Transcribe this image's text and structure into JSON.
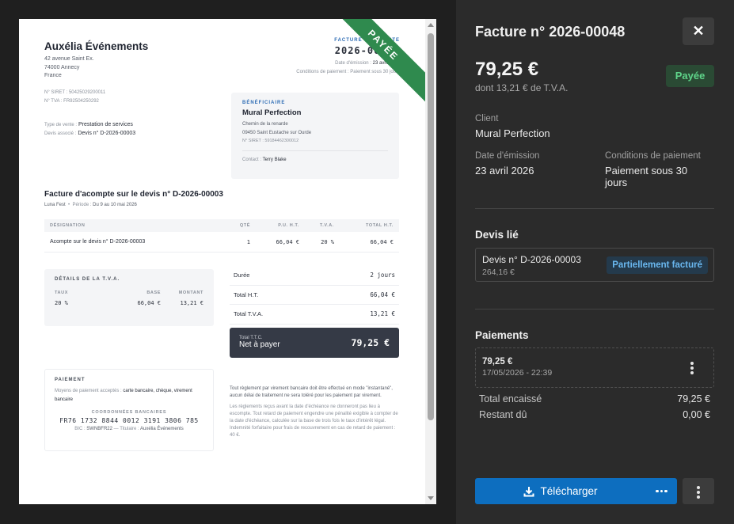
{
  "invoice_doc": {
    "company": {
      "name": "Auxélia Événements",
      "address_lines": [
        "42 avenue Saint Ex.",
        "74000 Annecy",
        "France"
      ],
      "siret": "N° SIRET : 50425029200011",
      "tva": "N° TVA : FR92504250292"
    },
    "sale_type_label": "Type de vente :",
    "sale_type_value": "Prestation de services",
    "quote_label": "Devis associé :",
    "quote_value": "Devis n° D-2026-00003",
    "header": {
      "label": "FACTURE D'ACOMPTE",
      "number": "2026-00048",
      "issue_label": "Date d'émission :",
      "issue_value": "23 avril 2026",
      "terms_label": "Conditions de paiement :",
      "terms_value": "Paiement sous 30 jours"
    },
    "ribbon": "PAYÉE",
    "beneficiary": {
      "label": "BÉNÉFICIAIRE",
      "name": "Mural Perfection",
      "address_lines": [
        "Chemin de la renarde",
        "09450 Saint Eustache sur Ourde"
      ],
      "siret": "N° SIRET : 59184462300012",
      "contact_label": "Contact :",
      "contact_value": "Terry Blake"
    },
    "title": "Facture d'acompte sur le devis n° D-2026-00003",
    "subtitle_event": "Luna Fest",
    "subtitle_period_label": "Période :",
    "subtitle_period_value": "Du 9 au 10 mai 2026",
    "items_headers": [
      "DÉSIGNATION",
      "QTÉ",
      "P.U. H.T.",
      "T.V.A.",
      "TOTAL H.T."
    ],
    "items_rows": [
      [
        "Acompte sur le devis n° D-2026-00003",
        "1",
        "66,04 €",
        "20 %",
        "66,04 €"
      ]
    ],
    "vat": {
      "label": "DÉTAILS DE LA T.V.A.",
      "headers": [
        "TAUX",
        "BASE",
        "MONTANT"
      ],
      "row": [
        "20 %",
        "66,04 €",
        "13,21 €"
      ]
    },
    "totals": [
      {
        "label": "Durée",
        "value": "2 jours"
      },
      {
        "label": "Total H.T.",
        "value": "66,04 €"
      },
      {
        "label": "Total T.V.A.",
        "value": "13,21 €"
      }
    ],
    "net": {
      "small": "Total T.T.C.",
      "label": "Net à payer",
      "amount": "79,25 €"
    },
    "payment": {
      "label": "PAIEMENT",
      "methods_label": "Moyens de paiement acceptés :",
      "methods_value": "carte bancaire, chèque, virement bancaire",
      "coords_label": "COORDONNÉES BANCAIRES",
      "iban": "FR76 1732 8844 0012 3191 3806 785",
      "bic_label": "BIC :",
      "bic_value": "SWNBFR22",
      "holder_label": "Titulaire :",
      "holder_value": "Auxélia Événements"
    },
    "legal_1": "Tout règlement par virement bancaire doit être effectué en mode \"instantané\", aucun délai de traitement ne sera toléré pour les paiement par virement.",
    "legal_2": "Les règlements reçus avant la date d'échéance ne donneront pas lieu à escompte. Tout retard de paiement engendre une pénalité exigible à compter de la date d'échéance, calculée sur la base de trois fois le taux d'intérêt légal. Indemnité forfaitaire pour frais de recouvrement en cas de retard de paiement : 40 €."
  },
  "panel": {
    "title": "Facture n° 2026-00048",
    "close_glyph": "✕",
    "amount": "79,25 €",
    "vat_note": "dont 13,21 € de T.V.A.",
    "status_badge": "Payée",
    "client_label": "Client",
    "client_value": "Mural Perfection",
    "issue_label": "Date d'émission",
    "issue_value": "23 avril 2026",
    "terms_label": "Conditions de paiement",
    "terms_value": "Paiement sous 30 jours",
    "linked_quote_title": "Devis lié",
    "linked_quote": {
      "number": "Devis n° D-2026-00003",
      "amount": "264,16 €",
      "status": "Partiellement facturé"
    },
    "payments_title": "Paiements",
    "payments": [
      {
        "amount": "79,25 €",
        "date": "17/05/2026 - 22:39"
      }
    ],
    "total_collected_label": "Total encaissé",
    "total_collected_value": "79,25 €",
    "remaining_label": "Restant dû",
    "remaining_value": "0,00 €",
    "download_label": "Télécharger"
  },
  "colors": {
    "accent_blue": "#0d6ebf",
    "paid_green": "#2f8a4e",
    "panel_bg": "#2b2b2b"
  },
  "icons": {
    "close": "close-icon",
    "download": "download-icon",
    "more": "more-horizontal-icon",
    "kebab": "kebab-icon"
  }
}
